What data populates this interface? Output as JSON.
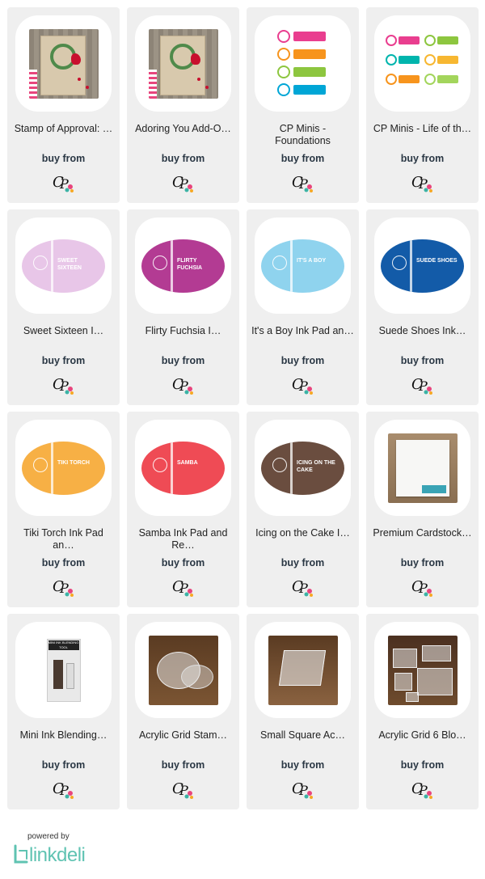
{
  "buy_label": "buy from",
  "products": [
    {
      "title": "Stamp of Approval: …",
      "type": "card",
      "color": "#c8102e"
    },
    {
      "title": "Adoring You Add-O…",
      "type": "card",
      "color": "#c8102e"
    },
    {
      "title": "CP Minis - Foundations",
      "type": "minis",
      "colors": [
        "#e93e8f",
        "#f7941d",
        "#8dc63f",
        "#00a6d6"
      ]
    },
    {
      "title": "CP Minis - Life of th…",
      "type": "minis-grid",
      "colors": [
        "#e93e8f",
        "#8dc63f",
        "#00b5ad",
        "#f7b731",
        "#f7941d",
        "#a3d55c"
      ]
    },
    {
      "title": "Sweet Sixteen I…",
      "type": "ink",
      "color": "#e8c6e8",
      "ink_label": "SWEET SIXTEEN"
    },
    {
      "title": "Flirty Fuchsia I…",
      "type": "ink",
      "color": "#b33b93",
      "ink_label": "FLIRTY FUCHSIA"
    },
    {
      "title": "It's a Boy Ink Pad an…",
      "type": "ink",
      "color": "#8fd3ee",
      "ink_label": "IT'S A BOY"
    },
    {
      "title": "Suede Shoes Ink…",
      "type": "ink",
      "color": "#135ba8",
      "ink_label": "SUEDE SHOES"
    },
    {
      "title": "Tiki Torch Ink Pad an…",
      "type": "ink",
      "color": "#f7b045",
      "ink_label": "TIKI TORCH"
    },
    {
      "title": "Samba Ink Pad and Re…",
      "type": "ink",
      "color": "#ef4b55",
      "ink_label": "SAMBA"
    },
    {
      "title": "Icing on the Cake I…",
      "type": "ink",
      "color": "#6a4d3f",
      "ink_label": "ICING ON THE CAKE"
    },
    {
      "title": "Premium Cardstock…",
      "type": "cardstock"
    },
    {
      "title": "Mini Ink Blending…",
      "type": "blender",
      "pack_label": "MINI INK BLENDING TOOL"
    },
    {
      "title": "Acrylic Grid Stam…",
      "type": "acrylic-round"
    },
    {
      "title": "Small Square Ac…",
      "type": "acrylic-square"
    },
    {
      "title": "Acrylic Grid 6 Blo…",
      "type": "acrylic-set"
    }
  ],
  "footer": {
    "powered_by": "powered by",
    "brand": "linkdeli"
  }
}
